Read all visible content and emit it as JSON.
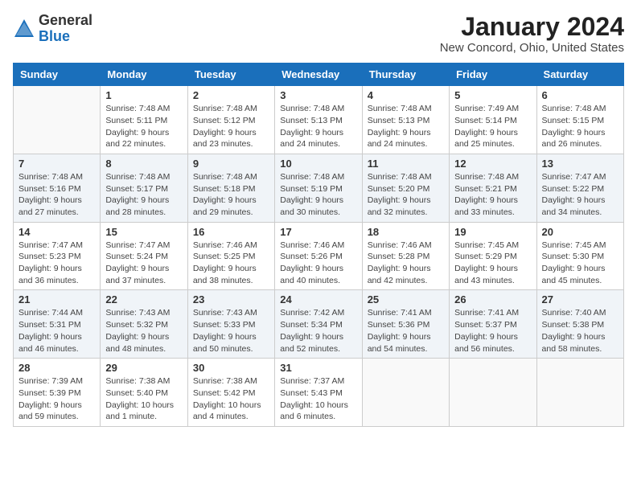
{
  "logo": {
    "general": "General",
    "blue": "Blue"
  },
  "title": "January 2024",
  "location": "New Concord, Ohio, United States",
  "days_of_week": [
    "Sunday",
    "Monday",
    "Tuesday",
    "Wednesday",
    "Thursday",
    "Friday",
    "Saturday"
  ],
  "weeks": [
    [
      {
        "num": "",
        "sunrise": "",
        "sunset": "",
        "daylight": ""
      },
      {
        "num": "1",
        "sunrise": "Sunrise: 7:48 AM",
        "sunset": "Sunset: 5:11 PM",
        "daylight": "Daylight: 9 hours and 22 minutes."
      },
      {
        "num": "2",
        "sunrise": "Sunrise: 7:48 AM",
        "sunset": "Sunset: 5:12 PM",
        "daylight": "Daylight: 9 hours and 23 minutes."
      },
      {
        "num": "3",
        "sunrise": "Sunrise: 7:48 AM",
        "sunset": "Sunset: 5:13 PM",
        "daylight": "Daylight: 9 hours and 24 minutes."
      },
      {
        "num": "4",
        "sunrise": "Sunrise: 7:48 AM",
        "sunset": "Sunset: 5:13 PM",
        "daylight": "Daylight: 9 hours and 24 minutes."
      },
      {
        "num": "5",
        "sunrise": "Sunrise: 7:49 AM",
        "sunset": "Sunset: 5:14 PM",
        "daylight": "Daylight: 9 hours and 25 minutes."
      },
      {
        "num": "6",
        "sunrise": "Sunrise: 7:48 AM",
        "sunset": "Sunset: 5:15 PM",
        "daylight": "Daylight: 9 hours and 26 minutes."
      }
    ],
    [
      {
        "num": "7",
        "sunrise": "Sunrise: 7:48 AM",
        "sunset": "Sunset: 5:16 PM",
        "daylight": "Daylight: 9 hours and 27 minutes."
      },
      {
        "num": "8",
        "sunrise": "Sunrise: 7:48 AM",
        "sunset": "Sunset: 5:17 PM",
        "daylight": "Daylight: 9 hours and 28 minutes."
      },
      {
        "num": "9",
        "sunrise": "Sunrise: 7:48 AM",
        "sunset": "Sunset: 5:18 PM",
        "daylight": "Daylight: 9 hours and 29 minutes."
      },
      {
        "num": "10",
        "sunrise": "Sunrise: 7:48 AM",
        "sunset": "Sunset: 5:19 PM",
        "daylight": "Daylight: 9 hours and 30 minutes."
      },
      {
        "num": "11",
        "sunrise": "Sunrise: 7:48 AM",
        "sunset": "Sunset: 5:20 PM",
        "daylight": "Daylight: 9 hours and 32 minutes."
      },
      {
        "num": "12",
        "sunrise": "Sunrise: 7:48 AM",
        "sunset": "Sunset: 5:21 PM",
        "daylight": "Daylight: 9 hours and 33 minutes."
      },
      {
        "num": "13",
        "sunrise": "Sunrise: 7:47 AM",
        "sunset": "Sunset: 5:22 PM",
        "daylight": "Daylight: 9 hours and 34 minutes."
      }
    ],
    [
      {
        "num": "14",
        "sunrise": "Sunrise: 7:47 AM",
        "sunset": "Sunset: 5:23 PM",
        "daylight": "Daylight: 9 hours and 36 minutes."
      },
      {
        "num": "15",
        "sunrise": "Sunrise: 7:47 AM",
        "sunset": "Sunset: 5:24 PM",
        "daylight": "Daylight: 9 hours and 37 minutes."
      },
      {
        "num": "16",
        "sunrise": "Sunrise: 7:46 AM",
        "sunset": "Sunset: 5:25 PM",
        "daylight": "Daylight: 9 hours and 38 minutes."
      },
      {
        "num": "17",
        "sunrise": "Sunrise: 7:46 AM",
        "sunset": "Sunset: 5:26 PM",
        "daylight": "Daylight: 9 hours and 40 minutes."
      },
      {
        "num": "18",
        "sunrise": "Sunrise: 7:46 AM",
        "sunset": "Sunset: 5:28 PM",
        "daylight": "Daylight: 9 hours and 42 minutes."
      },
      {
        "num": "19",
        "sunrise": "Sunrise: 7:45 AM",
        "sunset": "Sunset: 5:29 PM",
        "daylight": "Daylight: 9 hours and 43 minutes."
      },
      {
        "num": "20",
        "sunrise": "Sunrise: 7:45 AM",
        "sunset": "Sunset: 5:30 PM",
        "daylight": "Daylight: 9 hours and 45 minutes."
      }
    ],
    [
      {
        "num": "21",
        "sunrise": "Sunrise: 7:44 AM",
        "sunset": "Sunset: 5:31 PM",
        "daylight": "Daylight: 9 hours and 46 minutes."
      },
      {
        "num": "22",
        "sunrise": "Sunrise: 7:43 AM",
        "sunset": "Sunset: 5:32 PM",
        "daylight": "Daylight: 9 hours and 48 minutes."
      },
      {
        "num": "23",
        "sunrise": "Sunrise: 7:43 AM",
        "sunset": "Sunset: 5:33 PM",
        "daylight": "Daylight: 9 hours and 50 minutes."
      },
      {
        "num": "24",
        "sunrise": "Sunrise: 7:42 AM",
        "sunset": "Sunset: 5:34 PM",
        "daylight": "Daylight: 9 hours and 52 minutes."
      },
      {
        "num": "25",
        "sunrise": "Sunrise: 7:41 AM",
        "sunset": "Sunset: 5:36 PM",
        "daylight": "Daylight: 9 hours and 54 minutes."
      },
      {
        "num": "26",
        "sunrise": "Sunrise: 7:41 AM",
        "sunset": "Sunset: 5:37 PM",
        "daylight": "Daylight: 9 hours and 56 minutes."
      },
      {
        "num": "27",
        "sunrise": "Sunrise: 7:40 AM",
        "sunset": "Sunset: 5:38 PM",
        "daylight": "Daylight: 9 hours and 58 minutes."
      }
    ],
    [
      {
        "num": "28",
        "sunrise": "Sunrise: 7:39 AM",
        "sunset": "Sunset: 5:39 PM",
        "daylight": "Daylight: 9 hours and 59 minutes."
      },
      {
        "num": "29",
        "sunrise": "Sunrise: 7:38 AM",
        "sunset": "Sunset: 5:40 PM",
        "daylight": "Daylight: 10 hours and 1 minute."
      },
      {
        "num": "30",
        "sunrise": "Sunrise: 7:38 AM",
        "sunset": "Sunset: 5:42 PM",
        "daylight": "Daylight: 10 hours and 4 minutes."
      },
      {
        "num": "31",
        "sunrise": "Sunrise: 7:37 AM",
        "sunset": "Sunset: 5:43 PM",
        "daylight": "Daylight: 10 hours and 6 minutes."
      },
      {
        "num": "",
        "sunrise": "",
        "sunset": "",
        "daylight": ""
      },
      {
        "num": "",
        "sunrise": "",
        "sunset": "",
        "daylight": ""
      },
      {
        "num": "",
        "sunrise": "",
        "sunset": "",
        "daylight": ""
      }
    ]
  ]
}
